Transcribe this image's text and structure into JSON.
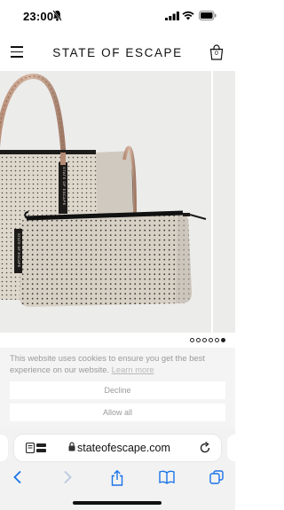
{
  "status_bar": {
    "time": "23:00",
    "icons": [
      "bell-slash-icon",
      "signal-icon",
      "wifi-icon",
      "battery-icon"
    ]
  },
  "header": {
    "brand": "STATE OF ESCAPE",
    "cart_count": "0",
    "icons": [
      "menu-icon",
      "shopping-bag-icon"
    ]
  },
  "product_gallery": {
    "slide_count": 6,
    "active_slide": 6
  },
  "cookie_banner": {
    "message": "This website uses cookies to ensure you get the best experience on our website.",
    "learn_more": "Learn more",
    "decline_label": "Decline",
    "allow_label": "Allow all"
  },
  "browser": {
    "url": "stateofescape.com",
    "icons": [
      "reader-icon",
      "lock-icon",
      "reload-icon"
    ]
  },
  "toolbar": {
    "icons": [
      "back-icon",
      "forward-icon",
      "share-icon",
      "bookmarks-icon",
      "tabs-icon"
    ]
  },
  "colors": {
    "accent": "#1a73e8",
    "bag_neoprene": "#ddd7cc",
    "background": "#ececeb"
  }
}
